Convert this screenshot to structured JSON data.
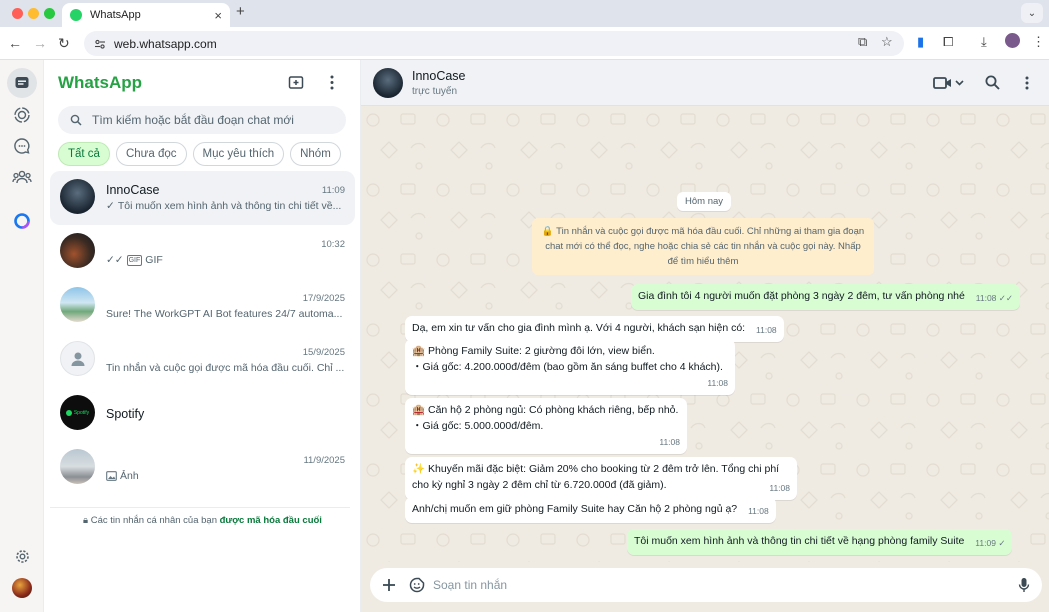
{
  "browser": {
    "tab_title": "WhatsApp",
    "tab_close": "×",
    "new_tab": "+",
    "url": "web.whatsapp.com"
  },
  "app": {
    "brand": "WhatsApp",
    "brand_color": "#25a244"
  },
  "search": {
    "placeholder": "Tìm kiếm hoặc bắt đầu đoạn chat mới"
  },
  "filters": [
    "Tất cả",
    "Chưa đọc",
    "Mục yêu thích",
    "Nhóm"
  ],
  "chats": [
    {
      "name": "InnoCase",
      "time": "11:09",
      "preview": "Tôi muốn xem hình ảnh và thông tin chi tiết về..."
    },
    {
      "name": "",
      "time": "10:32",
      "preview_badge": "GIF",
      "preview": "GIF"
    },
    {
      "name": "",
      "time": "17/9/2025",
      "preview": "Sure! The WorkGPT AI Bot features 24/7 automa..."
    },
    {
      "name": "",
      "time": "15/9/2025",
      "preview": "Tin nhắn và cuộc gọi được mã hóa đầu cuối. Chỉ ..."
    },
    {
      "name": "Spotify",
      "time": "",
      "preview": "",
      "avatar_text": "Spotify"
    },
    {
      "name": "",
      "time": "11/9/2025",
      "preview": "Ảnh"
    }
  ],
  "encryption_note": {
    "text": "Các tin nhắn cá nhân của bạn",
    "link": "được mã hóa đầu cuối"
  },
  "conversation": {
    "name": "InnoCase",
    "status": "trực tuyến",
    "date_label": "Hôm nay",
    "system_note": "🔒 Tin nhắn và cuộc gọi được mã hóa đầu cuối. Chỉ những ai tham gia đoạn chat mới có thể đọc, nghe hoặc chia sẻ các tin nhắn và cuộc gọi này. Nhấp để tìm hiểu thêm",
    "messages": [
      {
        "dir": "out",
        "text": "Gia đình tôi 4 người muốn đặt phòng 3 ngày 2 đêm, tư vấn phòng nhé",
        "time": "11:08"
      },
      {
        "dir": "in",
        "text": "Dạ, em xin tư vấn cho gia đình mình ạ. Với 4 người, khách sạn hiện có:",
        "time": "11:08"
      },
      {
        "dir": "in",
        "line1": "🏨 Phòng Family Suite: 2 giường đôi lớn, view biển.",
        "line2": "・Giá gốc: 4.200.000đ/đêm (bao gồm ăn sáng buffet cho 4 khách).",
        "time": "11:08"
      },
      {
        "dir": "in",
        "line1": "🏨 Căn hộ 2 phòng ngủ: Có phòng khách riêng, bếp nhỏ.",
        "line2": "・Giá gốc: 5.000.000đ/đêm.",
        "time": "11:08"
      },
      {
        "dir": "in",
        "line1": "✨ Khuyến mãi đặc biệt: Giảm 20% cho booking từ 2 đêm trở lên. Tổng chi phí",
        "line2": "cho kỳ nghỉ 3 ngày 2 đêm chỉ từ 6.720.000đ (đã giảm).",
        "time": "11:08"
      },
      {
        "dir": "in",
        "text": "Anh/chị muốn em giữ phòng Family Suite hay Căn hộ 2 phòng ngủ ạ?",
        "time": "11:08"
      },
      {
        "dir": "out",
        "text": "Tôi muốn xem hình ảnh và thông tin chi tiết về hạng phòng family Suite",
        "time": "11:09"
      }
    ]
  },
  "composer": {
    "placeholder": "Soạn tin nhắn"
  },
  "colors": {
    "outgoing_bubble": "#d9fdd3",
    "incoming_bubble": "#ffffff",
    "chat_bg": "#efeae2",
    "read_tick": "#53bdeb"
  }
}
